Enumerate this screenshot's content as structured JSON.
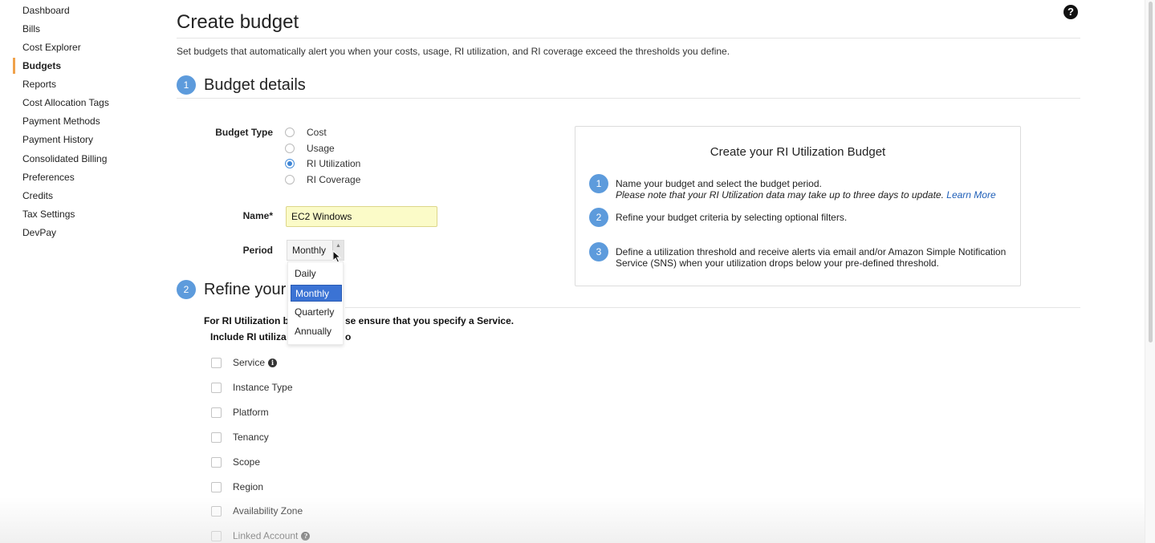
{
  "sidebar": {
    "items": [
      {
        "label": "Dashboard"
      },
      {
        "label": "Bills"
      },
      {
        "label": "Cost Explorer"
      },
      {
        "label": "Budgets",
        "active": true
      },
      {
        "label": "Reports"
      },
      {
        "label": "Cost Allocation Tags"
      },
      {
        "label": "Payment Methods"
      },
      {
        "label": "Payment History"
      },
      {
        "label": "Consolidated Billing"
      },
      {
        "label": "Preferences"
      },
      {
        "label": "Credits"
      },
      {
        "label": "Tax Settings"
      },
      {
        "label": "DevPay"
      }
    ],
    "accent_color": "#f0a24b"
  },
  "header": {
    "title": "Create budget",
    "subtitle": "Set budgets that automatically alert you when your costs, usage, RI utilization, and RI coverage exceed the thresholds you define.",
    "help_glyph": "?"
  },
  "section1": {
    "number": "1",
    "title": "Budget details",
    "budget_type_label": "Budget Type",
    "budget_types": [
      {
        "label": "Cost",
        "checked": false
      },
      {
        "label": "Usage",
        "checked": false
      },
      {
        "label": "RI Utilization",
        "checked": true
      },
      {
        "label": "RI Coverage",
        "checked": false
      }
    ],
    "name_label": "Name*",
    "name_value": "EC2 Windows",
    "period_label": "Period",
    "period_value": "Monthly",
    "period_options": [
      {
        "label": "Daily",
        "selected": false
      },
      {
        "label": "Monthly",
        "selected": true
      },
      {
        "label": "Quarterly",
        "selected": false
      },
      {
        "label": "Annually",
        "selected": false
      }
    ]
  },
  "section2": {
    "number": "2",
    "title": "Refine your",
    "note_start": "For RI Utilization b",
    "note_end": "se ensure that you specify a Service.",
    "include_start": "Include RI utiliza",
    "include_end": "o",
    "filters": [
      {
        "label": "Service",
        "info": true
      },
      {
        "label": "Instance Type",
        "info": false
      },
      {
        "label": "Platform",
        "info": false
      },
      {
        "label": "Tenancy",
        "info": false
      },
      {
        "label": "Scope",
        "info": false
      },
      {
        "label": "Region",
        "info": false
      },
      {
        "label": "Availability Zone",
        "info": false
      },
      {
        "label": "Linked Account",
        "info": true
      }
    ]
  },
  "info_panel": {
    "title": "Create your RI Utilization Budget",
    "steps": [
      {
        "number": "1",
        "text": "Name your budget and select the budget period.",
        "note": "Please note that your RI Utilization data may take up to three days to update.",
        "link": "Learn More"
      },
      {
        "number": "2",
        "text": "Refine your budget criteria by selecting optional filters."
      },
      {
        "number": "3",
        "text": "Define a utilization threshold and receive alerts via email and/or Amazon Simple Notification Service (SNS) when your utilization drops below your pre-defined threshold."
      }
    ]
  },
  "colors": {
    "step_badge": "#5d9bdc",
    "selected_option": "#3b73d4",
    "name_input_bg": "#fbfbc8",
    "link": "#1f5fb8"
  }
}
